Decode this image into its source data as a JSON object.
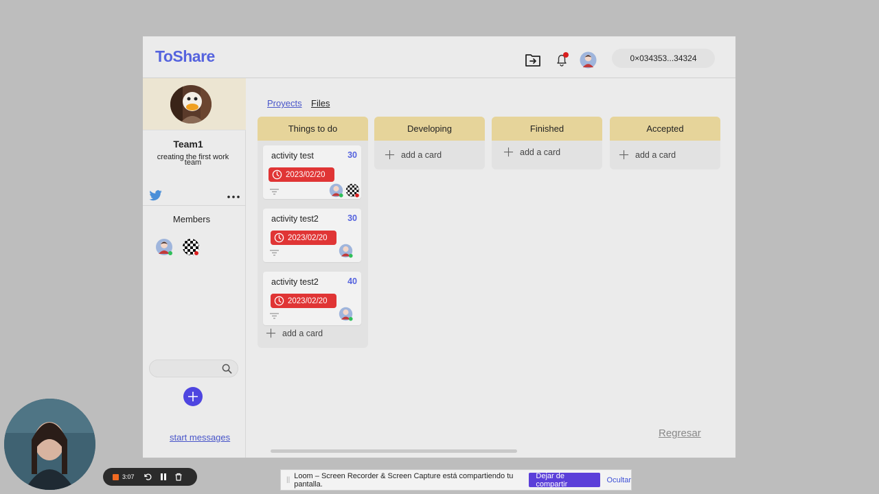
{
  "header": {
    "logo": "ToShare",
    "wallet": "0×034353...34324",
    "icons": [
      "folder-arrow-icon",
      "bell-icon",
      "avatar-icon"
    ]
  },
  "sidebar": {
    "team_name": "Team1",
    "team_description": "creating the first work team",
    "members_label": "Members",
    "search_placeholder": "",
    "start_messages": "start messages"
  },
  "tabs": [
    {
      "label": "Proyects",
      "active": true
    },
    {
      "label": "Files",
      "active": false
    }
  ],
  "columns": [
    {
      "title": "Things to do",
      "cards": [
        {
          "title": "activity test",
          "points": "30",
          "due": "2023/02/20"
        },
        {
          "title": "activity test2",
          "points": "30",
          "due": "2023/02/20"
        },
        {
          "title": "activity test2",
          "points": "40",
          "due": "2023/02/20"
        }
      ],
      "add_label": "add a card"
    },
    {
      "title": "Developing",
      "cards": [],
      "add_label": "add a card"
    },
    {
      "title": "Finished",
      "cards": [],
      "add_label": "add a card"
    },
    {
      "title": "Accepted",
      "cards": [],
      "add_label": "add a card"
    }
  ],
  "footer": {
    "back_link": "Regresar"
  },
  "recorder": {
    "time": "3:07"
  },
  "share_bar": {
    "message": "Loom – Screen Recorder & Screen Capture está compartiendo tu pantalla.",
    "stop_button": "Dejar de compartir",
    "hide_link": "Ocultar"
  },
  "colors": {
    "accent": "#5563de",
    "column_header": "#e6d49a",
    "due_badge": "#e03535",
    "add_button": "#4e45e0"
  }
}
